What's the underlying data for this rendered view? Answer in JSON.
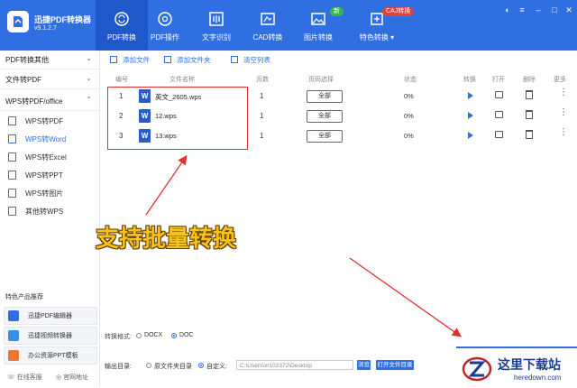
{
  "app": {
    "name": "迅捷PDF转换器",
    "version": "v9.1.2.7"
  },
  "nav": {
    "tabs": [
      {
        "label": "PDF转换",
        "icon": "refresh-icon",
        "active": true
      },
      {
        "label": "PDF操作",
        "icon": "gear-circle-icon"
      },
      {
        "label": "文字识别",
        "icon": "scan-text-icon"
      },
      {
        "label": "CAD转换",
        "icon": "cad-icon"
      },
      {
        "label": "图片转换",
        "icon": "image-icon"
      },
      {
        "label": "特色转换",
        "icon": "special-convert-icon"
      }
    ],
    "badge_new": "新",
    "badge_caj": "CAJ转换"
  },
  "sidebar": {
    "sections": [
      "PDF转换其他",
      "文件转PDF",
      "WPS转PDF/office"
    ],
    "items": [
      "WPS转PDF",
      "WPS转Word",
      "WPS转Excel",
      "WPS转PPT",
      "WPS转图片",
      "其他转WPS"
    ],
    "active_index": 1,
    "feature_title": "特色产品推荐",
    "features": [
      "迅捷PDF编辑器",
      "迅捷视频转换器",
      "办公资源PPT模板"
    ],
    "footer": {
      "service": "在线客服",
      "website": "官网地址"
    }
  },
  "toolbar": {
    "add_file": "添加文件",
    "add_folder": "添加文件夹",
    "clear": "清空列表"
  },
  "table": {
    "headers": [
      "编号",
      "文件名称",
      "页数",
      "页码选择",
      "状态",
      "转换",
      "打开",
      "删除",
      "更多"
    ],
    "rows": [
      {
        "num": "1",
        "name": "英文_2605.wps",
        "pages": "1",
        "range": "全部",
        "status": "0%"
      },
      {
        "num": "2",
        "name": "12.wps",
        "pages": "1",
        "range": "全部",
        "status": "0%"
      },
      {
        "num": "3",
        "name": "13.wps",
        "pages": "1",
        "range": "全部",
        "status": "0%"
      }
    ]
  },
  "caption": "支持批量转换",
  "format": {
    "label": "转换格式:",
    "options": [
      "DOCX",
      "DOC"
    ],
    "selected": "DOC"
  },
  "output": {
    "label": "输出目录:",
    "original": "原文件夹目录",
    "custom": "自定义:",
    "path": "C:\\Users\\xr102372\\Desktop",
    "browse": "浏览",
    "open_folder": "打开文件目录"
  },
  "watermark": {
    "cn": "这里下载站",
    "en": "heredown.com"
  },
  "colors": {
    "primary": "#2f6fe2",
    "highlight": "#e03131",
    "caption": "#f6c21a"
  }
}
